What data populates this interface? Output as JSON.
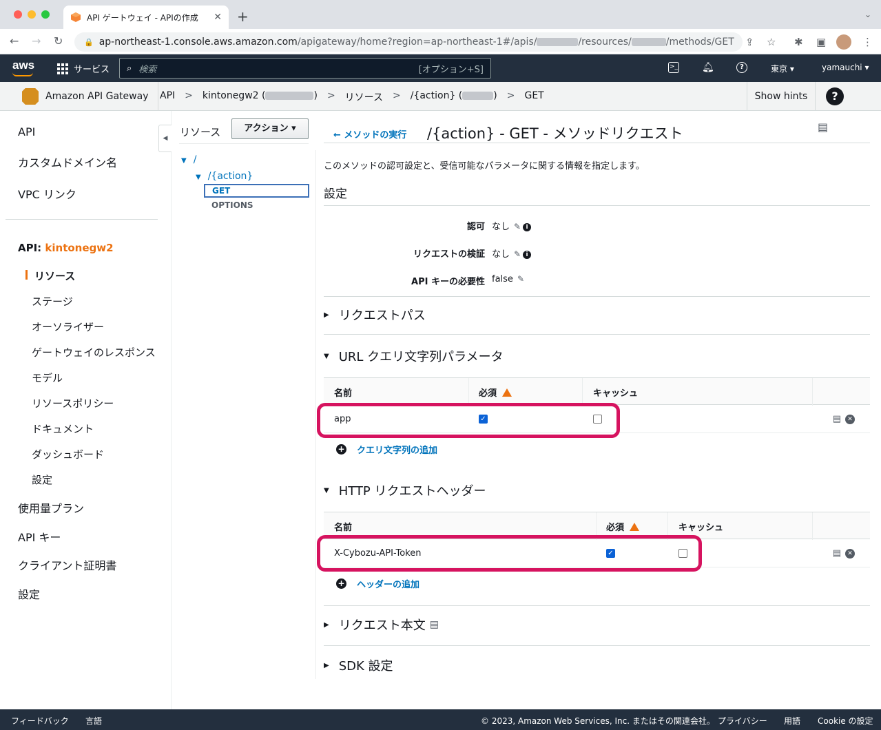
{
  "browser": {
    "tab_title": "API ゲートウェイ - APIの作成",
    "url_prefix": "ap-northeast-1.console.aws.amazon.com",
    "url_path1": "/apigateway/home?region=ap-northeast-1#/apis/",
    "url_path2": "/resources/",
    "url_path3": "/methods/GET"
  },
  "awsnav": {
    "logo": "aws",
    "services": "サービス",
    "search_placeholder": "検索",
    "search_shortcut": "[オプション+S]",
    "region": "東京 ▾",
    "user": "yamauchi ▾"
  },
  "breadcrumb": {
    "service": "Amazon API Gateway",
    "items": [
      "API",
      "kintonegw2 (",
      ")",
      "リソース",
      "/{action} (",
      ")",
      "GET"
    ],
    "sep": ">",
    "show_hints": "Show hints",
    "help": "?"
  },
  "leftnav": {
    "top_items": [
      "API",
      "カスタムドメイン名",
      "VPC リンク"
    ],
    "api_label": "API: ",
    "api_name": "kintonegw2",
    "sub_items": [
      "リソース",
      "ステージ",
      "オーソライザー",
      "ゲートウェイのレスポンス",
      "モデル",
      "リソースポリシー",
      "ドキュメント",
      "ダッシュボード",
      "設定"
    ],
    "bottom_items": [
      "使用量プラン",
      "API キー",
      "クライアント証明書",
      "設定"
    ]
  },
  "tree": {
    "title": "リソース",
    "action_button": "アクション ▾",
    "root": "/",
    "child": "/{action}",
    "selected": "GET",
    "other": "OPTIONS"
  },
  "main": {
    "back_link": "メソッドの実行",
    "title": "/{action} - GET - メソッドリクエスト",
    "description": "このメソッドの認可設定と、受信可能なパラメータに関する情報を指定します。",
    "settings_title": "設定",
    "settings": [
      {
        "label": "認可",
        "value": "なし"
      },
      {
        "label": "リクエストの検証",
        "value": "なし"
      },
      {
        "label": "API キーの必要性",
        "value": "false"
      }
    ],
    "sections": {
      "request_path": "リクエストパス",
      "query_params": "URL クエリ文字列パラメータ",
      "http_headers": "HTTP リクエストヘッダー",
      "request_body": "リクエスト本文",
      "sdk": "SDK 設定"
    },
    "table_headers": {
      "name": "名前",
      "required": "必須",
      "cache": "キャッシュ"
    },
    "query_rows": [
      {
        "name": "app",
        "required": true,
        "cache": false
      }
    ],
    "header_rows": [
      {
        "name": "X-Cybozu-API-Token",
        "required": true,
        "cache": false
      }
    ],
    "add_query": "クエリ文字列の追加",
    "add_header": "ヘッダーの追加"
  },
  "footer": {
    "feedback": "フィードバック",
    "language": "言語",
    "copyright": "© 2023, Amazon Web Services, Inc. またはその関連会社。",
    "privacy": "プライバシー",
    "terms": "用語",
    "cookie": "Cookie の設定"
  },
  "colors": {
    "aws_nav": "#232f3e",
    "link": "#0073bb",
    "accent_orange": "#ec7211",
    "highlight": "#d6135f",
    "checkbox": "#0b62d6"
  }
}
